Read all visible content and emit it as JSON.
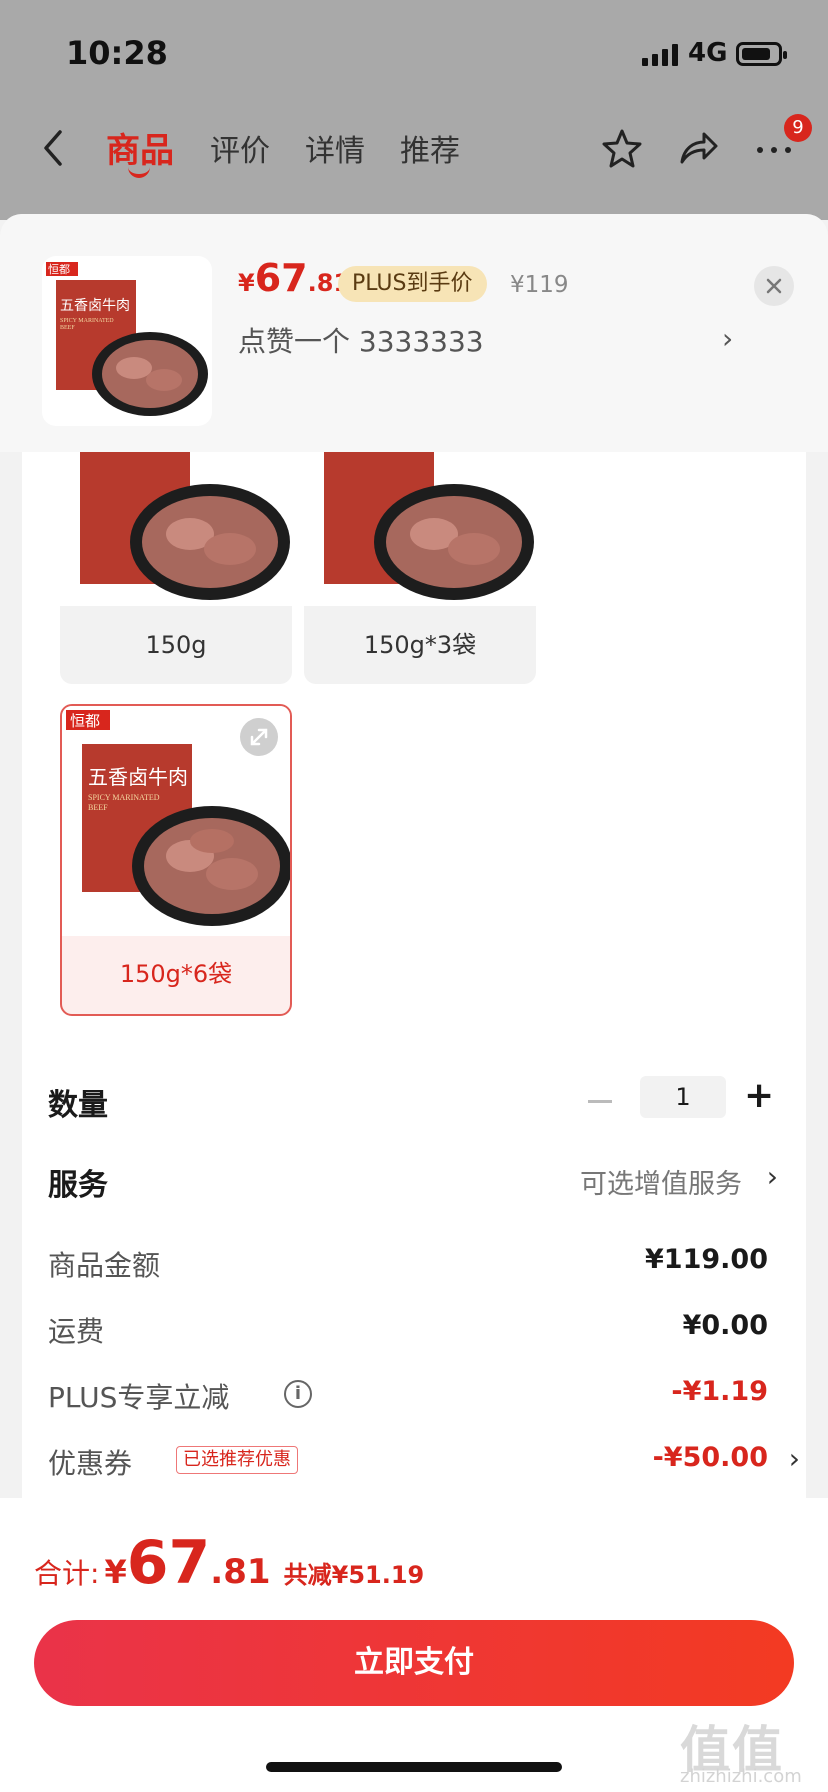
{
  "status_bar": {
    "time": "10:28",
    "network": "4G"
  },
  "nav": {
    "tabs": [
      {
        "label": "商品"
      },
      {
        "label": "评价"
      },
      {
        "label": "详情"
      },
      {
        "label": "推荐"
      }
    ],
    "badge_count": "9"
  },
  "header": {
    "price_symbol": "¥",
    "price_int": "67",
    "price_dec": ".81",
    "plus_label": "PLUS到手价",
    "original_price": "¥119",
    "selection_label": "点赞一个  3333333"
  },
  "product": {
    "brand": "恒都",
    "name": "五香卤牛肉",
    "name_en_1": "SPICY MARINATED",
    "name_en_2": "BEEF"
  },
  "options": [
    {
      "label": "150g",
      "selected": false
    },
    {
      "label": "150g*3袋",
      "selected": false
    },
    {
      "label": "150g*6袋",
      "selected": true
    }
  ],
  "quantity": {
    "label": "数量",
    "value": "1"
  },
  "service": {
    "label": "服务",
    "value": "可选增值服务"
  },
  "summary": {
    "goods_label": "商品金额",
    "goods_value": "¥119.00",
    "shipping_label": "运费",
    "shipping_value": "¥0.00",
    "plus_label": "PLUS专享立减",
    "plus_value": "-¥1.19",
    "coupon_label": "优惠券",
    "coupon_tag": "已选推荐优惠",
    "coupon_value": "-¥50.00"
  },
  "bottom": {
    "total_label": "合计:",
    "total_symbol": "¥",
    "total_int": "67",
    "total_dec": ".81",
    "total_cut": "共减¥51.19",
    "pay_label": "立即支付"
  },
  "watermark": {
    "text": "值值值",
    "url": "zhizhizhi.com"
  },
  "colors": {
    "accent": "#d8261d",
    "plus_tag": "#f7e4b6"
  }
}
